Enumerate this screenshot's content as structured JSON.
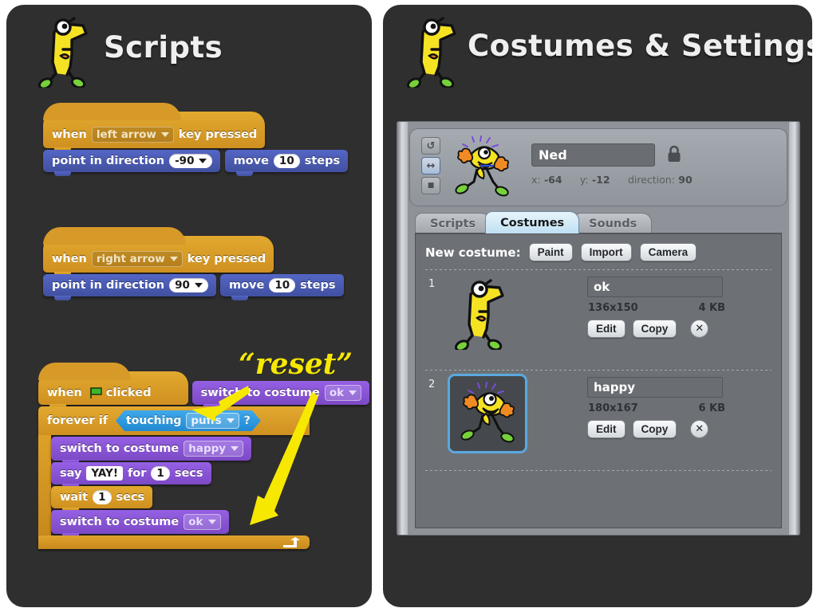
{
  "left_panel": {
    "title": "Scripts",
    "mascot": "ned-sprite-icon",
    "annotation": {
      "label": "“reset”",
      "color": "#f6e800",
      "arrow_count": 2
    },
    "scripts": [
      {
        "id": "script-left-arrow",
        "blocks": [
          {
            "type": "hat",
            "category": "control",
            "parts": [
              {
                "kind": "text",
                "value": "when"
              },
              {
                "kind": "dropdown",
                "style": "dark",
                "value": "left arrow"
              },
              {
                "kind": "text",
                "value": "key pressed"
              }
            ]
          },
          {
            "type": "stack",
            "category": "motion",
            "parts": [
              {
                "kind": "text",
                "value": "point in direction"
              },
              {
                "kind": "dropdown",
                "style": "white",
                "value": "-90"
              }
            ]
          },
          {
            "type": "stack",
            "category": "motion",
            "parts": [
              {
                "kind": "text",
                "value": "move"
              },
              {
                "kind": "number",
                "value": "10"
              },
              {
                "kind": "text",
                "value": "steps"
              }
            ]
          }
        ]
      },
      {
        "id": "script-right-arrow",
        "blocks": [
          {
            "type": "hat",
            "category": "control",
            "parts": [
              {
                "kind": "text",
                "value": "when"
              },
              {
                "kind": "dropdown",
                "style": "dark",
                "value": "right arrow"
              },
              {
                "kind": "text",
                "value": "key pressed"
              }
            ]
          },
          {
            "type": "stack",
            "category": "motion",
            "parts": [
              {
                "kind": "text",
                "value": "point in direction"
              },
              {
                "kind": "dropdown",
                "style": "white",
                "value": "90"
              }
            ]
          },
          {
            "type": "stack",
            "category": "motion",
            "parts": [
              {
                "kind": "text",
                "value": "move"
              },
              {
                "kind": "number",
                "value": "10"
              },
              {
                "kind": "text",
                "value": "steps"
              }
            ]
          }
        ]
      },
      {
        "id": "script-green-flag",
        "blocks": [
          {
            "type": "hat",
            "category": "control",
            "parts": [
              {
                "kind": "text",
                "value": "when"
              },
              {
                "kind": "icon",
                "value": "green-flag-icon"
              },
              {
                "kind": "text",
                "value": "clicked"
              }
            ]
          },
          {
            "type": "stack",
            "category": "looks",
            "parts": [
              {
                "kind": "text",
                "value": "switch to costume"
              },
              {
                "kind": "dropdown",
                "style": "purple",
                "value": "ok"
              }
            ]
          },
          {
            "type": "c-block",
            "category": "control",
            "head": [
              {
                "kind": "text",
                "value": "forever if"
              },
              {
                "kind": "reporter",
                "value": "touching",
                "arg": "puffs",
                "suffix": "?"
              }
            ],
            "body": [
              {
                "type": "stack",
                "category": "looks",
                "parts": [
                  {
                    "kind": "text",
                    "value": "switch to costume"
                  },
                  {
                    "kind": "dropdown",
                    "style": "purple",
                    "value": "happy"
                  }
                ]
              },
              {
                "type": "stack",
                "category": "looks",
                "parts": [
                  {
                    "kind": "text",
                    "value": "say"
                  },
                  {
                    "kind": "text-field",
                    "value": "YAY!"
                  },
                  {
                    "kind": "text",
                    "value": "for"
                  },
                  {
                    "kind": "number",
                    "value": "1"
                  },
                  {
                    "kind": "text",
                    "value": "secs"
                  }
                ]
              },
              {
                "type": "stack",
                "category": "control",
                "parts": [
                  {
                    "kind": "text",
                    "value": "wait"
                  },
                  {
                    "kind": "number",
                    "value": "1"
                  },
                  {
                    "kind": "text",
                    "value": "secs"
                  }
                ]
              },
              {
                "type": "stack",
                "category": "looks",
                "parts": [
                  {
                    "kind": "text",
                    "value": "switch to costume"
                  },
                  {
                    "kind": "dropdown",
                    "style": "purple",
                    "value": "ok"
                  }
                ]
              }
            ]
          }
        ]
      }
    ]
  },
  "right_panel": {
    "title": "Costumes & Settings",
    "mascot": "ned-sprite-icon",
    "sprite": {
      "name": "Ned",
      "lock_icon": "lock-icon",
      "x_label": "x:",
      "x_value": "-64",
      "y_label": "y:",
      "y_value": "-12",
      "direction_label": "direction:",
      "direction_value": "90",
      "rotation_buttons": [
        {
          "name": "rotate-freely-button",
          "glyph": "↺",
          "selected": false
        },
        {
          "name": "left-right-flip-button",
          "glyph": "↔",
          "selected": true
        },
        {
          "name": "no-rotation-button",
          "glyph": "■",
          "selected": false
        }
      ]
    },
    "tabs": [
      {
        "label": "Scripts",
        "active": false
      },
      {
        "label": "Costumes",
        "active": true
      },
      {
        "label": "Sounds",
        "active": false
      }
    ],
    "new_costume": {
      "label": "New costume:",
      "buttons": [
        "Paint",
        "Import",
        "Camera"
      ]
    },
    "costumes": [
      {
        "index": "1",
        "name": "ok",
        "dimensions": "136x150",
        "size": "4 KB",
        "selected": false,
        "thumb": "ned-standing-icon",
        "edit_label": "Edit",
        "copy_label": "Copy",
        "delete_label": "✕"
      },
      {
        "index": "2",
        "name": "happy",
        "dimensions": "180x167",
        "size": "6 KB",
        "selected": true,
        "thumb": "ned-happy-icon",
        "edit_label": "Edit",
        "copy_label": "Copy",
        "delete_label": "✕"
      }
    ]
  },
  "colors": {
    "page_background": "#ffffff",
    "panel_background": "#302f2f",
    "control_block": "#d79a28",
    "motion_block": "#4b59b5",
    "looks_block": "#8a55d7",
    "sensing_block": "#2e9ae0",
    "annotation": "#f6e800",
    "ui_grey": "#8f9399",
    "pane_grey": "#6d7176",
    "tab_active": "#bfe0f3"
  }
}
